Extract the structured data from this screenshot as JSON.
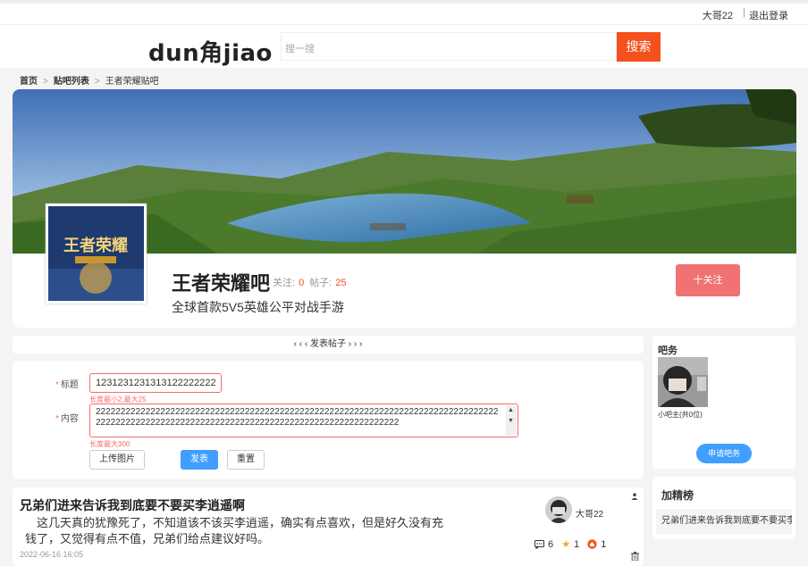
{
  "topbar": {
    "username": "大哥22",
    "separator": "|",
    "logout": "退出登录"
  },
  "header": {
    "logo_left": "dun",
    "logo_mid": "角",
    "logo_right": "jiao",
    "search_placeholder": "搜一搜",
    "search_button": "搜索"
  },
  "breadcrumb": {
    "home": "首页",
    "list": "贴吧列表",
    "current": "王者荣耀贴吧",
    "separator": ">"
  },
  "bar": {
    "name": "王者荣耀吧",
    "follow_label": "关注:",
    "follow_count": "0",
    "posts_label": "帖子:",
    "posts_count": "25",
    "description": "全球首款5V5英雄公平对战手游",
    "follow_button": "十关注",
    "avatar_text": "王者荣耀"
  },
  "toggle": {
    "label": "‹ ‹ ‹  发表帖子  › › ›"
  },
  "form": {
    "title_label": "标题",
    "title_value": "1231231231313122222222",
    "title_hint": "长度最小2,最大25",
    "content_label": "内容",
    "content_value": "2222222222222222222222222222222222222222222222222222222222222222222222222222222222222222222222222222222222222222222222222222222222222222222222",
    "content_hint": "长度最大300",
    "upload_button": "上传图片",
    "post_button": "发表",
    "reset_button": "重置",
    "required_mark": "*"
  },
  "post": {
    "title": "兄弟们进来告诉我到底要不要买李逍遥啊",
    "body": "这几天真的犹豫死了，不知道该不该买李逍遥，确实有点喜欢，但是好久没有充钱了，又觉得有点不值，兄弟们给点建议好吗。",
    "time": "2022-06-16 16:05",
    "author": "大哥22",
    "comments": "6",
    "stars": "1",
    "likes": "1"
  },
  "side": {
    "moderator_title": "吧务",
    "moderator_label": "小吧主(共0位)",
    "apply_button": "申请吧务",
    "featured_title": "加精榜",
    "featured_item": "兄弟们进来告诉我到底要不要买李逍遥啊"
  },
  "colors": {
    "accent_orange": "#f4511e",
    "follow_red": "#f07272",
    "primary_blue": "#409eff",
    "error_red": "#f56c6c"
  }
}
